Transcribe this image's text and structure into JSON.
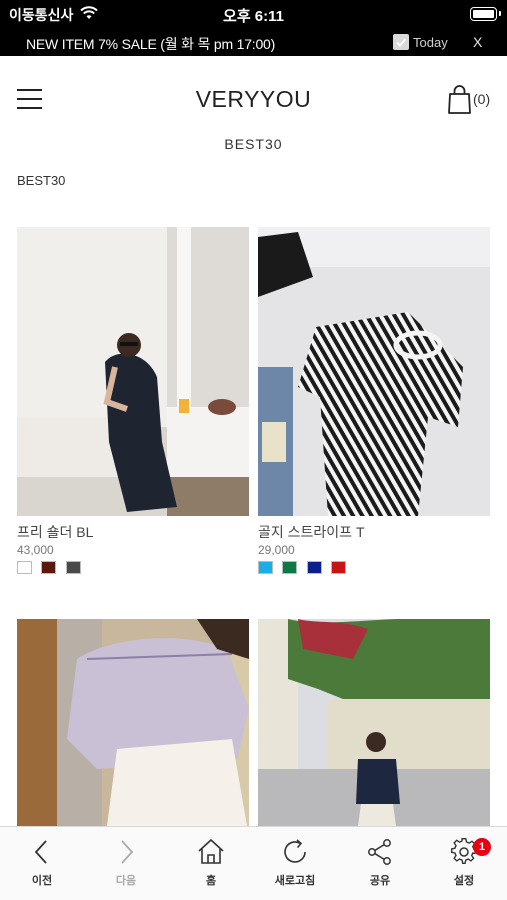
{
  "status_bar": {
    "carrier": "이동통신사",
    "time": "오후 6:11"
  },
  "notice": {
    "text": "NEW ITEM 7% SALE (월 화 목 pm 17:00)",
    "today_label": "Today",
    "close_label": "X"
  },
  "header": {
    "brand": "VERYYOU",
    "cart_count": "(0)"
  },
  "page": {
    "subtitle": "BEST30",
    "breadcrumb": "BEST30"
  },
  "products": [
    {
      "name": "프리 숄더 BL",
      "price": "43,000",
      "swatches": [
        "#ffffff",
        "#5a1a0e",
        "#4a4a4a"
      ]
    },
    {
      "name": "골지 스트라이프 T",
      "price": "29,000",
      "swatches": [
        "#1aaee6",
        "#0b7a44",
        "#0a1f8c",
        "#c81414"
      ]
    },
    {
      "name": "",
      "price": "",
      "swatches": []
    },
    {
      "name": "",
      "price": "",
      "swatches": []
    }
  ],
  "toolbar": {
    "items": [
      {
        "label": "이전",
        "icon": "chevron-left-icon"
      },
      {
        "label": "다음",
        "icon": "chevron-right-icon"
      },
      {
        "label": "홈",
        "icon": "home-icon"
      },
      {
        "label": "새로고침",
        "icon": "refresh-icon"
      },
      {
        "label": "공유",
        "icon": "share-icon"
      },
      {
        "label": "설정",
        "icon": "gear-icon"
      }
    ],
    "settings_badge": "1"
  }
}
